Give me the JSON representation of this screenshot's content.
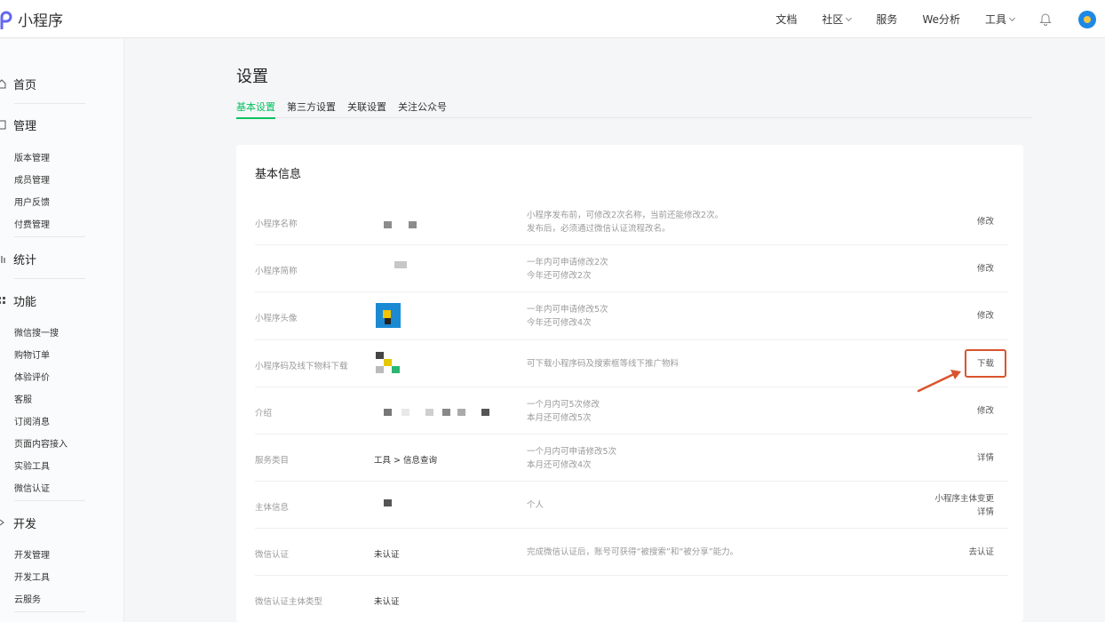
{
  "header": {
    "logo_text": "小程序",
    "nav": [
      "文档",
      "社区",
      "服务",
      "We分析",
      "工具"
    ]
  },
  "sidebar": {
    "home": "首页",
    "manage": {
      "title": "管理",
      "items": [
        "版本管理",
        "成员管理",
        "用户反馈",
        "付费管理"
      ]
    },
    "stats": "统计",
    "features": {
      "title": "功能",
      "items": [
        "微信搜一搜",
        "购物订单",
        "体验评价",
        "客服",
        "订阅消息",
        "页面内容接入",
        "实验工具",
        "微信认证"
      ]
    },
    "develop": {
      "title": "开发",
      "items": [
        "开发管理",
        "开发工具",
        "云服务"
      ]
    }
  },
  "page": {
    "title": "设置",
    "tabs": [
      "基本设置",
      "第三方设置",
      "关联设置",
      "关注公众号"
    ],
    "card_title": "基本信息"
  },
  "rows": [
    {
      "label": "小程序名称",
      "desc": [
        "小程序发布前，可修改2次名称，当前还能修改2次。",
        "发布后，必须通过微信认证流程改名。"
      ],
      "action": [
        "修改"
      ]
    },
    {
      "label": "小程序简称",
      "desc": [
        "一年内可申请修改2次",
        "今年还可修改2次"
      ],
      "action": [
        "修改"
      ]
    },
    {
      "label": "小程序头像",
      "desc": [
        "一年内可申请修改5次",
        "今年还可修改4次"
      ],
      "action": [
        "修改"
      ]
    },
    {
      "label": "小程序码及线下物料下载",
      "desc": [
        "可下载小程序码及搜索框等线下推广物料"
      ],
      "action": [
        "下载"
      ]
    },
    {
      "label": "介绍",
      "desc": [
        "一个月内可5次修改",
        "本月还可修改5次"
      ],
      "action": [
        "修改"
      ]
    },
    {
      "label": "服务类目",
      "value": "工具 > 信息查询",
      "desc": [
        "一个月内可申请修改5次",
        "本月还可修改4次"
      ],
      "action": [
        "详情"
      ]
    },
    {
      "label": "主体信息",
      "desc": [
        "个人"
      ],
      "action": [
        "小程序主体变更",
        "详情"
      ]
    },
    {
      "label": "微信认证",
      "value": "未认证",
      "desc": [
        "完成微信认证后，账号可获得“被搜索”和“被分享”能力。"
      ],
      "action": [
        "去认证"
      ]
    },
    {
      "label": "微信认证主体类型",
      "value": "未认证",
      "desc": [],
      "action": []
    }
  ],
  "colors": {
    "accent": "#07c160",
    "highlight": "#d9542e"
  }
}
